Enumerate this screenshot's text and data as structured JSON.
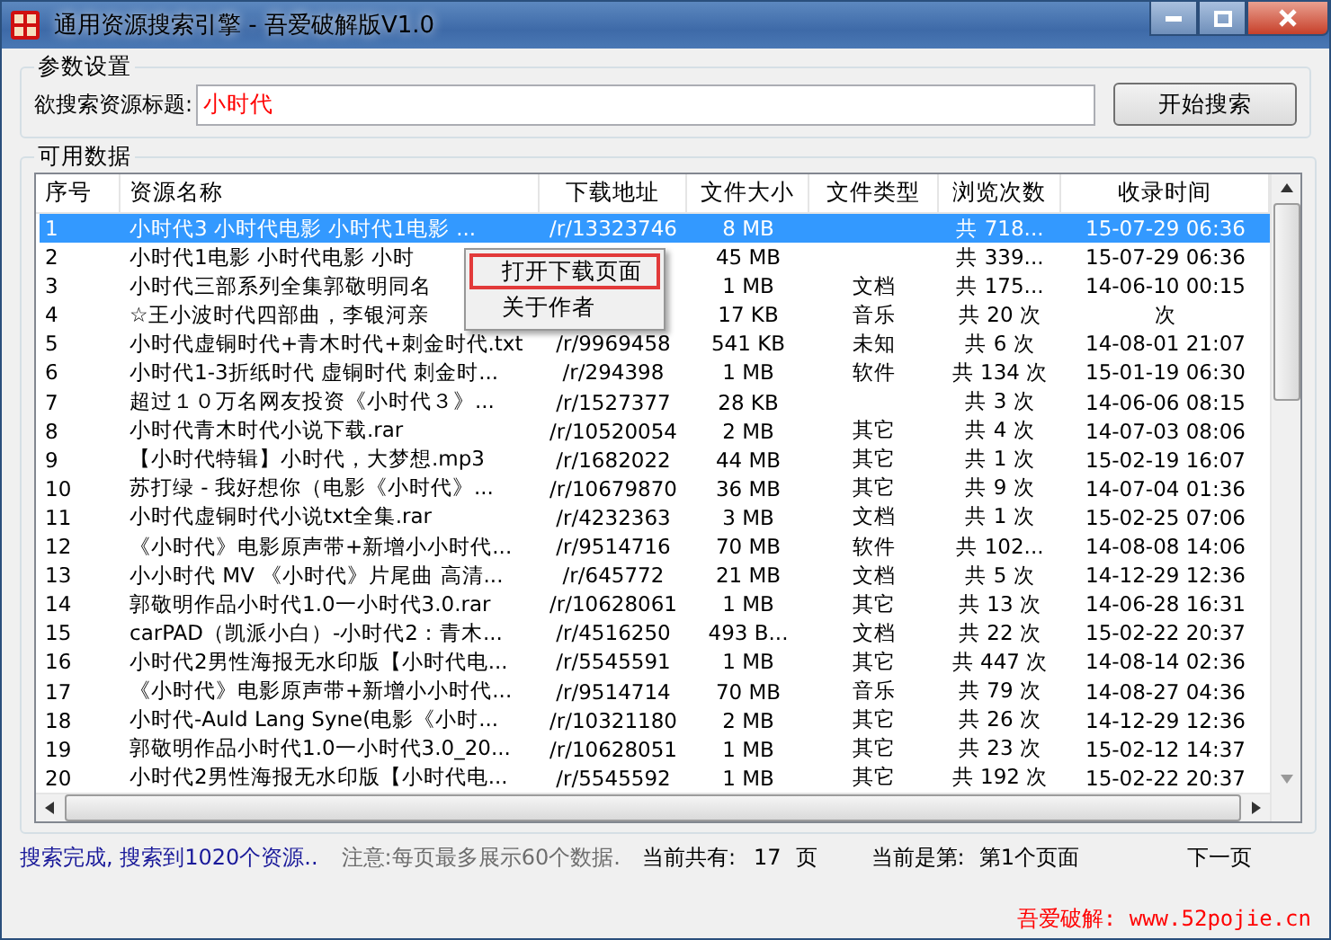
{
  "window": {
    "title": "通用资源搜索引擎 - 吾爱破解版V1.0"
  },
  "params": {
    "title": "参数设置",
    "label": "欲搜索资源标题:",
    "value": "小时代",
    "button": "开始搜索"
  },
  "data": {
    "title": "可用数据",
    "columns": [
      "序号",
      "资源名称",
      "下载地址",
      "文件大小",
      "文件类型",
      "浏览次数",
      "收录时间"
    ],
    "rows": [
      {
        "no": "1",
        "name": "小时代3  小时代电影  小时代1电影 ...",
        "url": "/r/13323746",
        "size": "8 MB",
        "type": "",
        "views": "共 718...",
        "time": "15-07-29 06:36",
        "selected": true
      },
      {
        "no": "2",
        "name": "小时代1电影  小时代电影  小时",
        "url": "",
        "size": "45 MB",
        "type": "",
        "views": "共 339...",
        "time": "15-07-29 06:36",
        "selected": false
      },
      {
        "no": "3",
        "name": "小时代三部系列全集郭敬明同名",
        "url": "",
        "size": "1 MB",
        "type": "文档",
        "views": "共 175...",
        "time": "14-06-10 00:15",
        "selected": false
      },
      {
        "no": "4",
        "name": "☆王小波时代四部曲，李银河亲",
        "url": "",
        "size": "17 KB",
        "type": "音乐",
        "views": "共 20 次",
        "time": "次",
        "selected": false
      },
      {
        "no": "5",
        "name": "小时代虚铜时代+青木时代+刺金时代.txt",
        "url": "/r/9969458",
        "size": "541 KB",
        "type": "未知",
        "views": "共 6 次",
        "time": "14-08-01 21:07",
        "selected": false
      },
      {
        "no": "6",
        "name": "小时代1-3折纸时代 虚铜时代 刺金时...",
        "url": "/r/294398",
        "size": "1 MB",
        "type": "软件",
        "views": "共 134 次",
        "time": "15-01-19 06:30",
        "selected": false
      },
      {
        "no": "7",
        "name": "超过１０万名网友投资《小时代３》...",
        "url": "/r/1527377",
        "size": "28 KB",
        "type": "",
        "views": "共 3 次",
        "time": "14-06-06 08:15",
        "selected": false
      },
      {
        "no": "8",
        "name": "小时代青木时代小说下载.rar",
        "url": "/r/10520054",
        "size": "2 MB",
        "type": "其它",
        "views": "共 4 次",
        "time": "14-07-03 08:06",
        "selected": false
      },
      {
        "no": "9",
        "name": "【小时代特辑】小时代，大梦想.mp3",
        "url": "/r/1682022",
        "size": "44 MB",
        "type": "其它",
        "views": "共 1 次",
        "time": "15-02-19 16:07",
        "selected": false
      },
      {
        "no": "10",
        "name": "苏打绿 - 我好想你（电影《小时代》...",
        "url": "/r/10679870",
        "size": "36 MB",
        "type": "其它",
        "views": "共 9 次",
        "time": "14-07-04 01:36",
        "selected": false
      },
      {
        "no": "11",
        "name": "小时代虚铜时代小说txt全集.rar",
        "url": "/r/4232363",
        "size": "3 MB",
        "type": "文档",
        "views": "共 1 次",
        "time": "15-02-25 07:06",
        "selected": false
      },
      {
        "no": "12",
        "name": "《小时代》电影原声带+新增小小时代...",
        "url": "/r/9514716",
        "size": "70 MB",
        "type": "软件",
        "views": "共 102...",
        "time": "14-08-08 14:06",
        "selected": false
      },
      {
        "no": "13",
        "name": "小小时代 MV 《小时代》片尾曲 高清...",
        "url": "/r/645772",
        "size": "21 MB",
        "type": "文档",
        "views": "共 5 次",
        "time": "14-12-29 12:36",
        "selected": false
      },
      {
        "no": "14",
        "name": "郭敬明作品小时代1.0一小时代3.0.rar",
        "url": "/r/10628061",
        "size": "1 MB",
        "type": "其它",
        "views": "共 13 次",
        "time": "14-06-28 16:31",
        "selected": false
      },
      {
        "no": "15",
        "name": "carPAD（凯派小白）-小时代2：青木...",
        "url": "/r/4516250",
        "size": "493 B...",
        "type": "文档",
        "views": "共 22 次",
        "time": "15-02-22 20:37",
        "selected": false
      },
      {
        "no": "16",
        "name": "小时代2男性海报无水印版【小时代电...",
        "url": "/r/5545591",
        "size": "1 MB",
        "type": "其它",
        "views": "共 447 次",
        "time": "14-08-14 02:36",
        "selected": false
      },
      {
        "no": "17",
        "name": "《小时代》电影原声带+新增小小时代...",
        "url": "/r/9514714",
        "size": "70 MB",
        "type": "音乐",
        "views": "共 79 次",
        "time": "14-08-27 04:36",
        "selected": false
      },
      {
        "no": "18",
        "name": "小时代-Auld Lang Syne(电影《小时...",
        "url": "/r/10321180",
        "size": "2 MB",
        "type": "其它",
        "views": "共 26 次",
        "time": "14-12-29 12:36",
        "selected": false
      },
      {
        "no": "19",
        "name": "郭敬明作品小时代1.0一小时代3.0_20...",
        "url": "/r/10628051",
        "size": "1 MB",
        "type": "其它",
        "views": "共 23 次",
        "time": "15-02-12 14:37",
        "selected": false
      },
      {
        "no": "20",
        "name": "小时代2男性海报无水印版【小时代电...",
        "url": "/r/5545592",
        "size": "1 MB",
        "type": "其它",
        "views": "共 192 次",
        "time": "15-02-22 20:37",
        "selected": false
      }
    ]
  },
  "context_menu": [
    {
      "label": "打开下载页面",
      "selected": true
    },
    {
      "label": "关于作者",
      "selected": false
    }
  ],
  "status": {
    "result": "搜索完成, 搜索到1020个资源..",
    "note": "注意:每页最多展示60个数据.",
    "total_label": "当前共有:",
    "total_pages": "17",
    "pages_unit": "页",
    "current_label": "当前是第:",
    "current_page": "第1个页面",
    "next": "下一页",
    "credit": "吾爱破解: www.52pojie.cn"
  }
}
